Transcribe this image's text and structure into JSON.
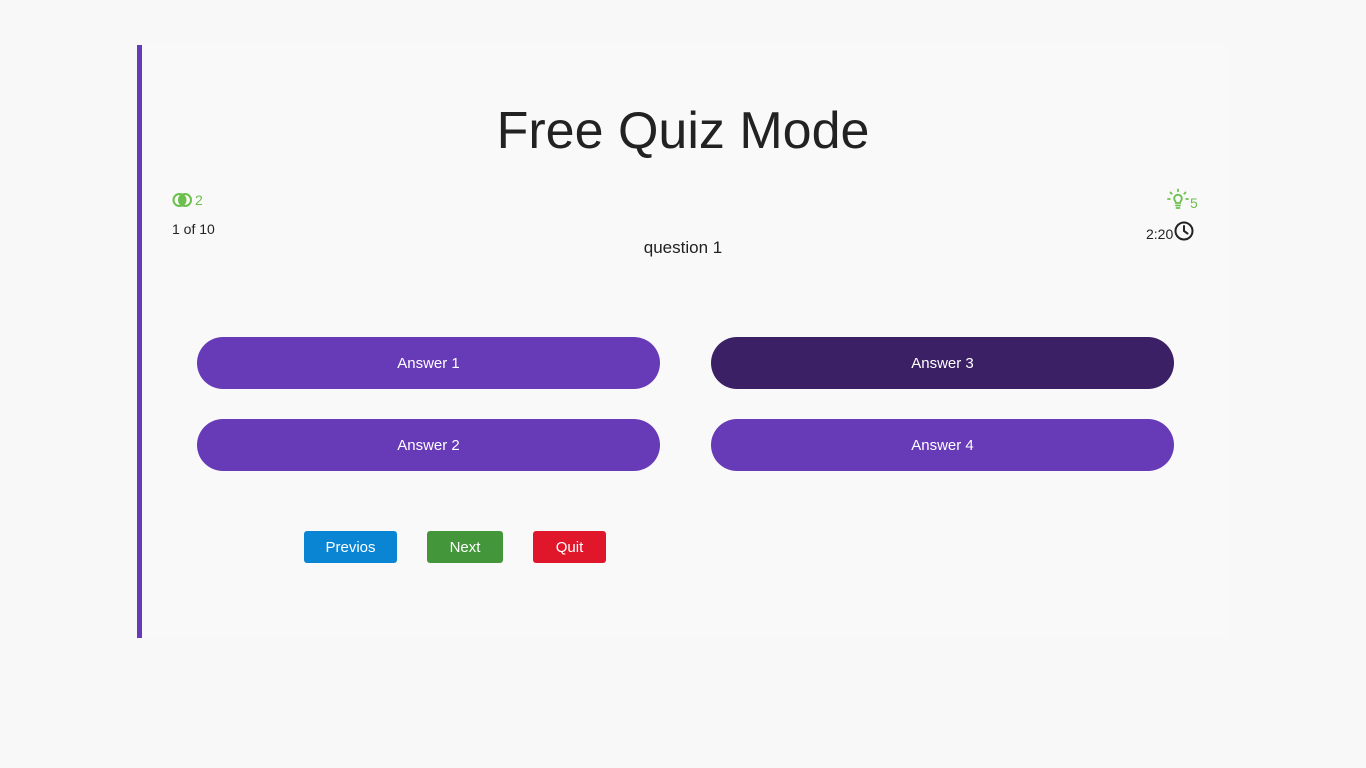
{
  "quiz": {
    "title": "Free Quiz Mode",
    "fifty_fifty_count": "2",
    "hints_count": "5",
    "progress": "1 of 10",
    "timer": "2:20",
    "question": "question 1"
  },
  "answers": [
    {
      "label": "Answer 1",
      "selected": false
    },
    {
      "label": "Answer 2",
      "selected": false
    },
    {
      "label": "Answer 3",
      "selected": true
    },
    {
      "label": "Answer 4",
      "selected": false
    }
  ],
  "buttons": {
    "previous": "Previos",
    "next": "Next",
    "quit": "Quit"
  },
  "colors": {
    "accent": "#673ab7",
    "selected": "#3b2066",
    "lifeline": "#6cbf4d",
    "previous": "#0a85d4",
    "next": "#43963a",
    "quit": "#e0162b"
  },
  "icons": {
    "fifty_fifty": "fifty-fifty-icon",
    "hints": "lightbulb-icon",
    "timer": "clock-icon"
  }
}
